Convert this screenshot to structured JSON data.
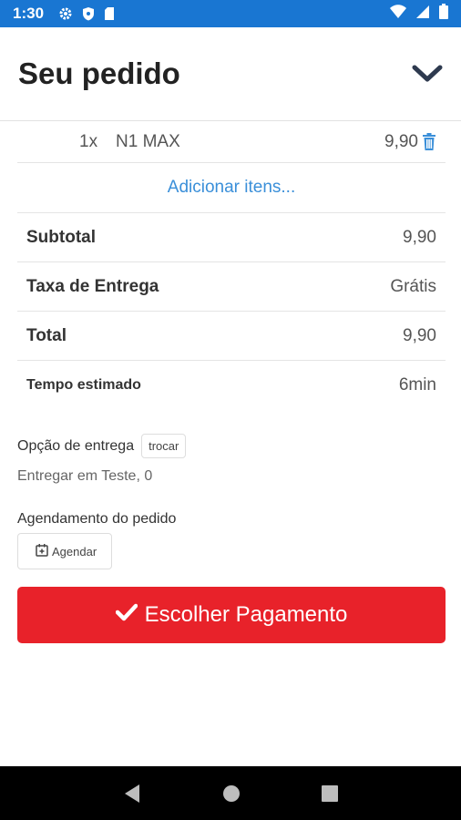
{
  "status_bar": {
    "time": "1:30"
  },
  "header": {
    "title": "Seu pedido"
  },
  "order": {
    "items": [
      {
        "qty": "1x",
        "name": "N1 MAX",
        "price": "9,90"
      }
    ],
    "add_items_label": "Adicionar itens...",
    "summary": [
      {
        "label": "Subtotal",
        "value": "9,90"
      },
      {
        "label": "Taxa de Entrega",
        "value": "Grátis"
      },
      {
        "label": "Total",
        "value": "9,90"
      },
      {
        "label": "Tempo estimado",
        "value": "6min"
      }
    ]
  },
  "delivery": {
    "title": "Opção de entrega",
    "change_label": "trocar",
    "address": "Entregar em Teste, 0"
  },
  "schedule": {
    "title": "Agendamento do pedido",
    "button_label": "Agendar"
  },
  "payment_button": {
    "label": "Escolher Pagamento"
  },
  "colors": {
    "status_bar": "#1976d2",
    "accent": "#e8222a",
    "link": "#3a8fd9"
  }
}
